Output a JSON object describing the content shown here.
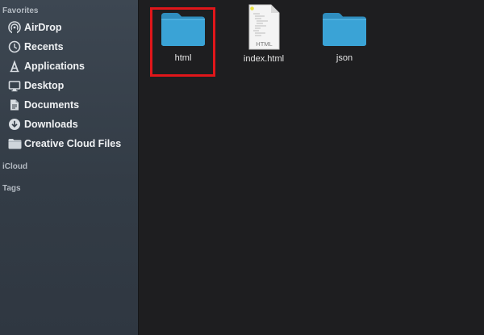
{
  "sidebar": {
    "favorites_title": "Favorites",
    "items": [
      {
        "label": "AirDrop",
        "icon": "airdrop-icon"
      },
      {
        "label": "Recents",
        "icon": "recents-icon"
      },
      {
        "label": "Applications",
        "icon": "applications-icon"
      },
      {
        "label": "Desktop",
        "icon": "desktop-icon"
      },
      {
        "label": "Documents",
        "icon": "documents-icon"
      },
      {
        "label": "Downloads",
        "icon": "downloads-icon"
      },
      {
        "label": "Creative Cloud Files",
        "icon": "folder-icon"
      }
    ],
    "icloud_title": "iCloud",
    "tags_title": "Tags"
  },
  "files": [
    {
      "name": "html",
      "type": "folder",
      "selected": true
    },
    {
      "name": "index.html",
      "type": "html-document",
      "icon_caption": "HTML"
    },
    {
      "name": "json",
      "type": "folder"
    }
  ],
  "colors": {
    "folder_blue": "#3aa3d6",
    "selection_outline": "#e0161a",
    "sidebar_bg": "#3a444f",
    "content_bg": "#1e1e20"
  }
}
